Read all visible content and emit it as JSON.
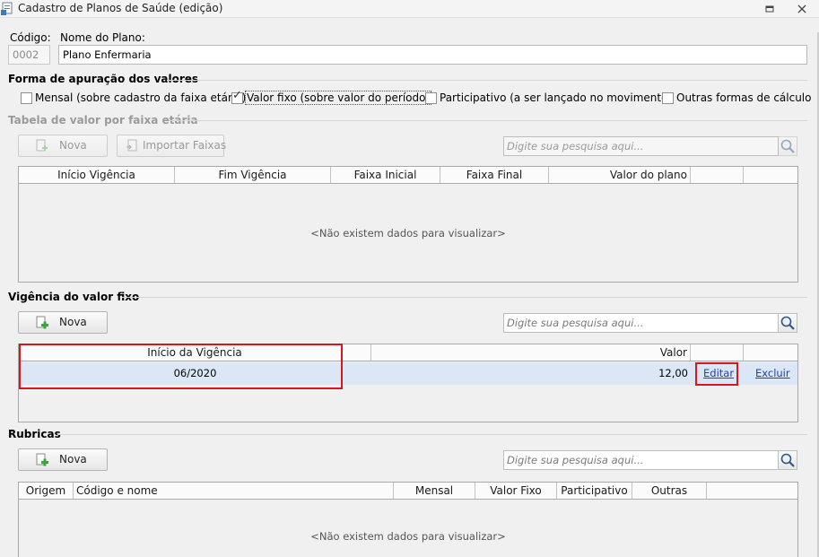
{
  "window": {
    "title": "Cadastro de Planos de Saúde (edição)",
    "restore_glyph": "▫",
    "close_glyph": "✕"
  },
  "form": {
    "codigo_label": "Código:",
    "codigo_value": "0002",
    "nome_label": "Nome do Plano:",
    "nome_value": "Plano Enfermaria"
  },
  "forma_apuracao": {
    "title": "Forma de apuração dos valores",
    "options": [
      {
        "label": "Mensal (sobre cadastro da faixa etária)",
        "checked": false
      },
      {
        "label": "Valor fixo (sobre valor do período)",
        "checked": true
      },
      {
        "label": "Participativo (a ser lançado no movimento)",
        "checked": false
      },
      {
        "label": "Outras formas de cálculo",
        "checked": false
      }
    ],
    "check_glyph": "✓"
  },
  "tabela_faixa": {
    "title": "Tabela de valor por faixa etária",
    "enabled": false,
    "nova_label": "Nova",
    "importar_label": "Importar Faixas",
    "search_placeholder": "Digite sua pesquisa aqui...",
    "columns": [
      "Início Vigência",
      "Fim Vigência",
      "Faixa Inicial",
      "Faixa Final",
      "Valor do plano",
      "",
      ""
    ],
    "empty_message": "<Não existem dados para visualizar>"
  },
  "vigencia": {
    "title": "Vigência do valor fixo",
    "nova_label": "Nova",
    "search_placeholder": "Digite sua pesquisa aqui...",
    "columns": [
      "Início da Vigência",
      "",
      "Valor",
      "",
      ""
    ],
    "rows": [
      {
        "inicio": "06/2020",
        "valor": "12,00",
        "editar": "Editar",
        "excluir": "Excluir"
      }
    ]
  },
  "rubricas": {
    "title": "Rubricas",
    "nova_label": "Nova",
    "search_placeholder": "Digite sua pesquisa aqui...",
    "columns": [
      "Origem",
      "Código e nome",
      "Mensal",
      "Valor Fixo",
      "Participativo",
      "Outras",
      ""
    ],
    "empty_message": "<Não existem dados para visualizar>"
  },
  "colors": {
    "highlight_red": "#d4181e",
    "link_blue": "#1f3fb5",
    "selected_row": "#dbe7f5",
    "add_icon_green": "#3aa53a"
  },
  "icons": {
    "window": "document-form-icon",
    "add": "add-document-icon",
    "import": "import-icon",
    "search": "magnifier-icon"
  }
}
